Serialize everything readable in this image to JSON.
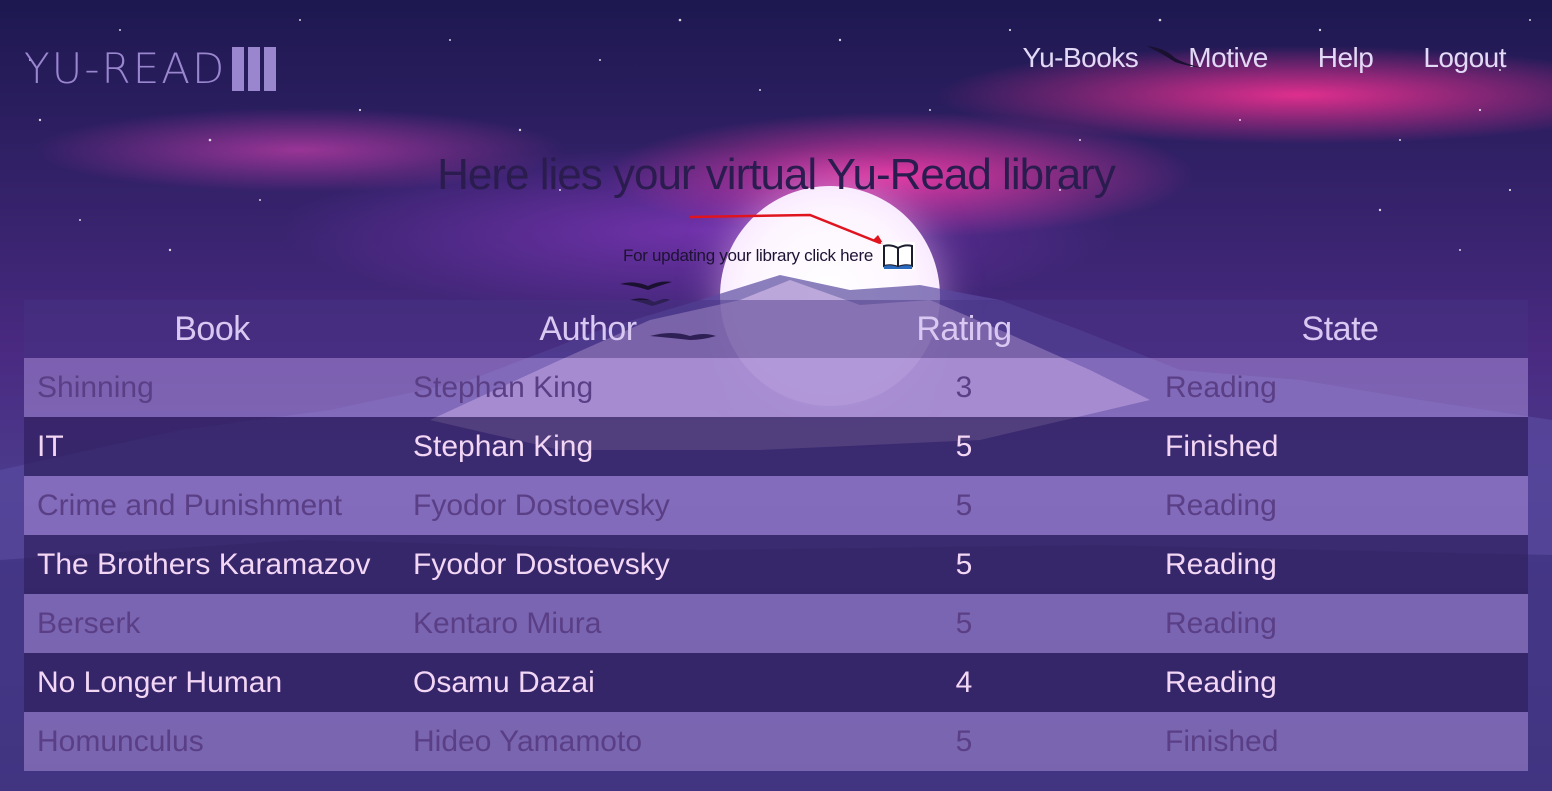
{
  "header": {
    "logo_text": "YU-READ",
    "nav": [
      "Yu-Books",
      "Motive",
      "Help",
      "Logout"
    ]
  },
  "main": {
    "heading": "Here lies your virtual Yu-Read library",
    "update_text": "For updating your library click here",
    "update_icon": "open-book-icon"
  },
  "table": {
    "columns": [
      "Book",
      "Author",
      "Rating",
      "State"
    ],
    "rows": [
      {
        "book": "Shinning",
        "author": "Stephan King",
        "rating": "3",
        "state": "Reading"
      },
      {
        "book": "IT",
        "author": "Stephan King",
        "rating": "5",
        "state": "Finished"
      },
      {
        "book": "Crime and Punishment",
        "author": "Fyodor Dostoevsky",
        "rating": "5",
        "state": "Reading"
      },
      {
        "book": "The Brothers Karamazov",
        "author": "Fyodor Dostoevsky",
        "rating": "5",
        "state": "Reading"
      },
      {
        "book": "Berserk",
        "author": "Kentaro Miura",
        "rating": "5",
        "state": "Reading"
      },
      {
        "book": "No Longer Human",
        "author": "Osamu Dazai",
        "rating": "4",
        "state": "Reading"
      },
      {
        "book": "Homunculus",
        "author": "Hideo Yamamoto",
        "rating": "5",
        "state": "Finished"
      }
    ]
  },
  "colors": {
    "logo": "#9a86cf",
    "nav_text": "#e3d9f6",
    "light_row_text": "#5b3f86",
    "dark_row_text": "#f2d6f4",
    "annotation_arrow": "#e0141e"
  }
}
